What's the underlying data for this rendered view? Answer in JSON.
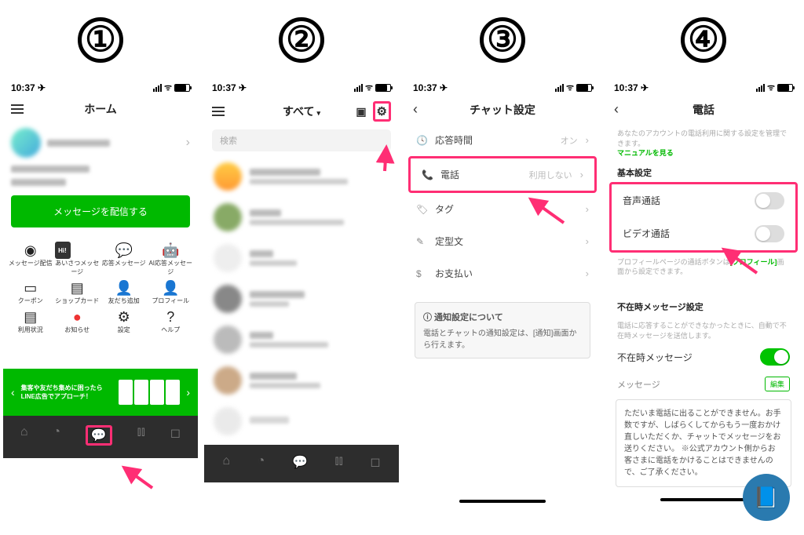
{
  "steps": [
    "①",
    "②",
    "③",
    "④"
  ],
  "status": {
    "time": "10:37 ✈︎"
  },
  "screen1": {
    "title": "ホーム",
    "green_button": "メッセージを配信する",
    "grid": [
      {
        "icon": "◉",
        "label": "メッセージ配信"
      },
      {
        "icon": "Hi!",
        "label": "あいさつメッセージ"
      },
      {
        "icon": "💬",
        "label": "応答メッセージ"
      },
      {
        "icon": "🤖",
        "label": "AI応答メッセージ"
      },
      {
        "icon": "🎫",
        "label": "クーポン"
      },
      {
        "icon": "🗂",
        "label": "ショップカード"
      },
      {
        "icon": "👤+",
        "label": "友だち追加"
      },
      {
        "icon": "👤",
        "label": "プロフィール"
      },
      {
        "icon": "📊",
        "label": "利用状況"
      },
      {
        "icon": "●",
        "label": "お知らせ"
      },
      {
        "icon": "⚙",
        "label": "設定"
      },
      {
        "icon": "?",
        "label": "ヘルプ"
      }
    ],
    "banner_text": "集客や友だち集めに困ったら\nLINE広告でアプローチ！"
  },
  "screen2": {
    "title": "すべて",
    "search_placeholder": "検索"
  },
  "screen3": {
    "title": "チャット設定",
    "rows": [
      {
        "icon": "🕓",
        "label": "応答時間",
        "value": "オン"
      },
      {
        "icon": "📞",
        "label": "電話",
        "value": "利用しない",
        "highlight": true
      },
      {
        "icon": "🏷",
        "label": "タグ",
        "value": ""
      },
      {
        "icon": "✎",
        "label": "定型文",
        "value": ""
      },
      {
        "icon": "$",
        "label": "お支払い",
        "value": ""
      }
    ],
    "notice_title": "ⓘ 通知設定について",
    "notice_body": "電話とチャットの通知設定は、[通知]画面から行えます。"
  },
  "screen4": {
    "title": "電話",
    "sub1": "あなたのアカウントの電話利用に関する設定を管理できます。",
    "manual_link": "マニュアルを見る",
    "section_basic": "基本設定",
    "voice_call": "音声通話",
    "video_call": "ビデオ通話",
    "sub2_a": "プロフィールページの通話ボタンは",
    "sub2_link": "[プロフィール]",
    "sub2_b": "画面から設定できます。",
    "section_away": "不在時メッセージ設定",
    "sub3": "電話に応答することができなかったときに、自動で不在時メッセージを送信します。",
    "away_label": "不在時メッセージ",
    "message_label": "メッセージ",
    "edit": "編集",
    "message_body": "ただいま電話に出ることができません。お手数ですが、しばらくしてからもう一度おかけ直しいただくか、チャットでメッセージをお送りください。 ※公式アカウント側からお客さまに電話をかけることはできませんので、ご了承ください。"
  }
}
